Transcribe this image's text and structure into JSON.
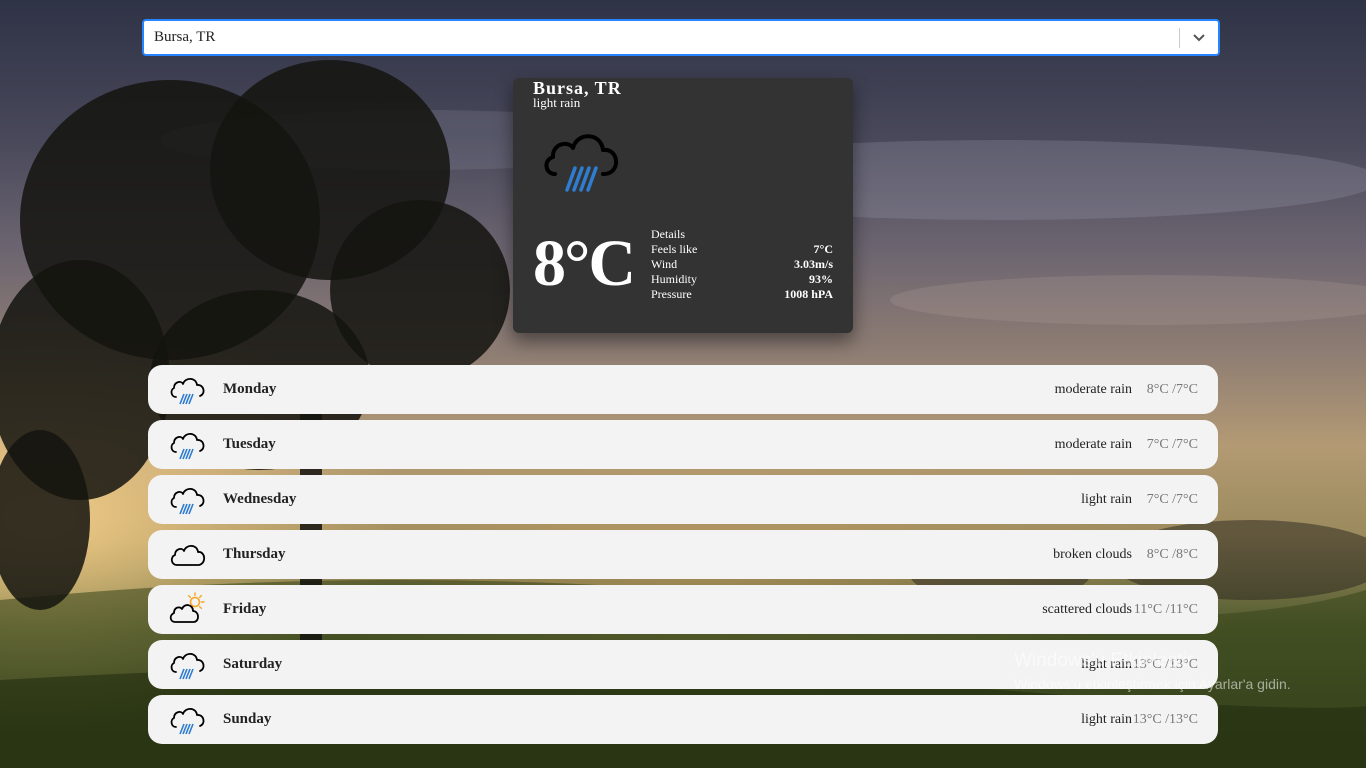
{
  "search": {
    "value": "Bursa, TR"
  },
  "current": {
    "city": "Bursa, TR",
    "description": "light rain",
    "icon": "rain-cloud-icon",
    "temperature": "8°C",
    "details_title": "Details",
    "details": [
      {
        "label": "Feels like",
        "value": "7°C"
      },
      {
        "label": "Wind",
        "value": "3.03m/s"
      },
      {
        "label": "Humidity",
        "value": "93%"
      },
      {
        "label": "Pressure",
        "value": "1008 hPA"
      }
    ]
  },
  "forecast": [
    {
      "day": "Monday",
      "description": "moderate rain",
      "temp": "8°C /7°C",
      "icon": "rain-cloud-icon"
    },
    {
      "day": "Tuesday",
      "description": "moderate rain",
      "temp": "7°C /7°C",
      "icon": "rain-cloud-icon"
    },
    {
      "day": "Wednesday",
      "description": "light rain",
      "temp": "7°C /7°C",
      "icon": "rain-cloud-icon"
    },
    {
      "day": "Thursday",
      "description": "broken clouds",
      "temp": "8°C /8°C",
      "icon": "cloud-icon"
    },
    {
      "day": "Friday",
      "description": "scattered clouds",
      "temp": "11°C /11°C",
      "icon": "sun-cloud-icon"
    },
    {
      "day": "Saturday",
      "description": "light rain",
      "temp": "13°C /13°C",
      "icon": "rain-cloud-icon"
    },
    {
      "day": "Sunday",
      "description": "light rain",
      "temp": "13°C /13°C",
      "icon": "rain-cloud-icon"
    }
  ],
  "watermark": {
    "title": "Windows'u Etkinleştir",
    "subtitle": "Windows'u etkinleştirmek için Ayarlar'a gidin."
  },
  "colors": {
    "accent": "#2684ff",
    "card": "#333333",
    "rain": "#2e7dd1",
    "sun": "#f5a623"
  }
}
